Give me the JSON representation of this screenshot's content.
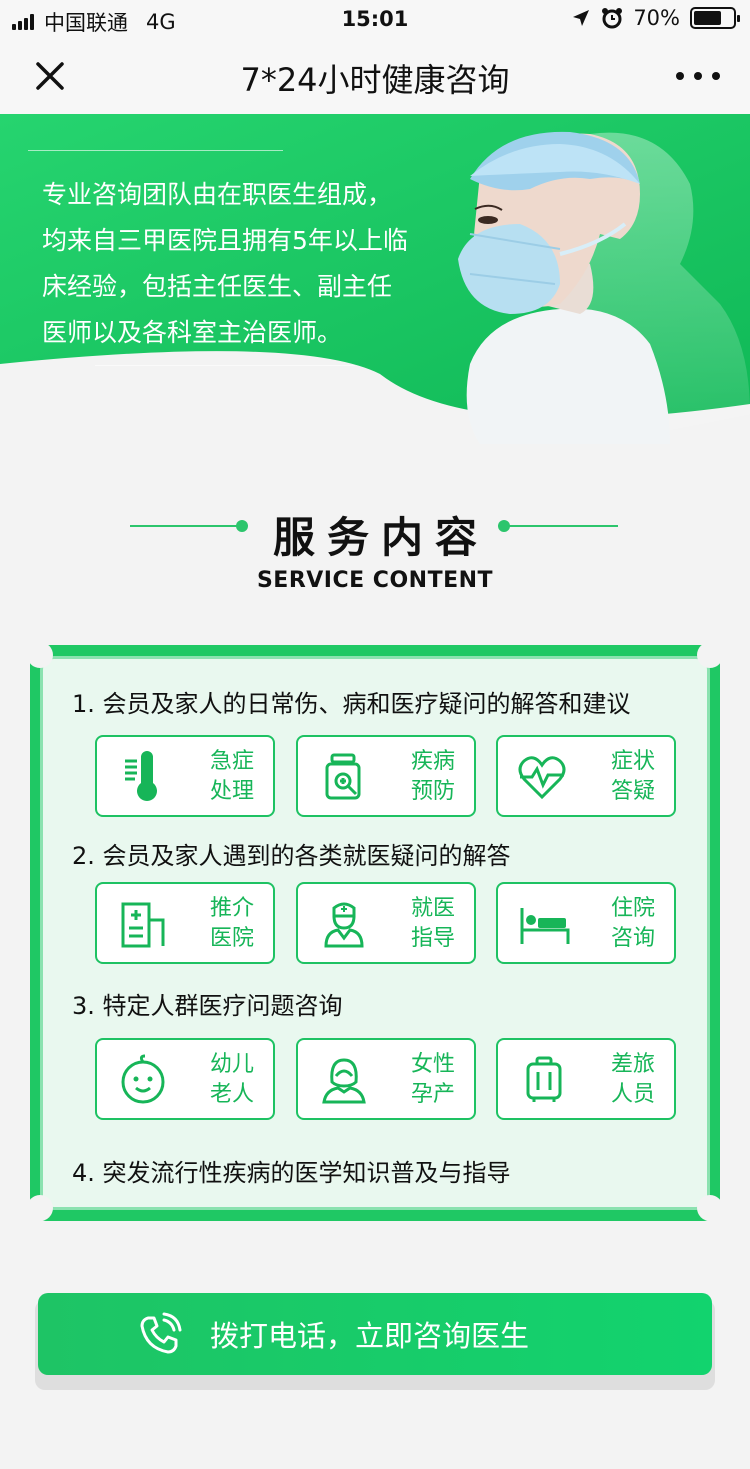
{
  "status_bar": {
    "carrier": "中国联通",
    "network": "4G",
    "time": "15:01",
    "battery": "70%",
    "battery_level": 0.7
  },
  "nav": {
    "title": "7*24小时健康咨询",
    "close_icon": "close-icon",
    "more_icon": "more-icon"
  },
  "hero": {
    "lines": [
      "专业咨询团队由在职医生组成，",
      "均来自三甲医院且拥有5年以上临",
      "床经验，包括主任医生、副主任",
      "医师以及各科室主治医师。"
    ]
  },
  "section": {
    "title_zh": "服务内容",
    "title_en": "SERVICE CONTENT"
  },
  "services": [
    {
      "title": "1. 会员及家人的日常伤、病和医疗疑问的解答和建议",
      "tiles": [
        {
          "line1": "急症",
          "line2": "处理",
          "icon": "thermometer-icon"
        },
        {
          "line1": "疾病",
          "line2": "预防",
          "icon": "medicine-bottle-icon"
        },
        {
          "line1": "症状",
          "line2": "答疑",
          "icon": "heart-pulse-icon"
        }
      ]
    },
    {
      "title": "2. 会员及家人遇到的各类就医疑问的解答",
      "tiles": [
        {
          "line1": "推介",
          "line2": "医院",
          "icon": "hospital-icon"
        },
        {
          "line1": "就医",
          "line2": "指导",
          "icon": "doctor-icon"
        },
        {
          "line1": "住院",
          "line2": "咨询",
          "icon": "bed-icon"
        }
      ]
    },
    {
      "title": "3. 特定人群医疗问题咨询",
      "tiles": [
        {
          "line1": "幼儿",
          "line2": "老人",
          "icon": "baby-face-icon"
        },
        {
          "line1": "女性",
          "line2": "孕产",
          "icon": "woman-icon"
        },
        {
          "line1": "差旅",
          "line2": "人员",
          "icon": "suitcase-icon"
        }
      ]
    },
    {
      "title": "4. 突发流行性疾病的医学知识普及与指导",
      "tiles": []
    }
  ],
  "call": {
    "label": "拨打电话，立即咨询医生",
    "icon": "phone-icon"
  },
  "colors": {
    "accent": "#1ec263",
    "accent_light": "#e9f8ef",
    "card_border": "#1fc864"
  }
}
